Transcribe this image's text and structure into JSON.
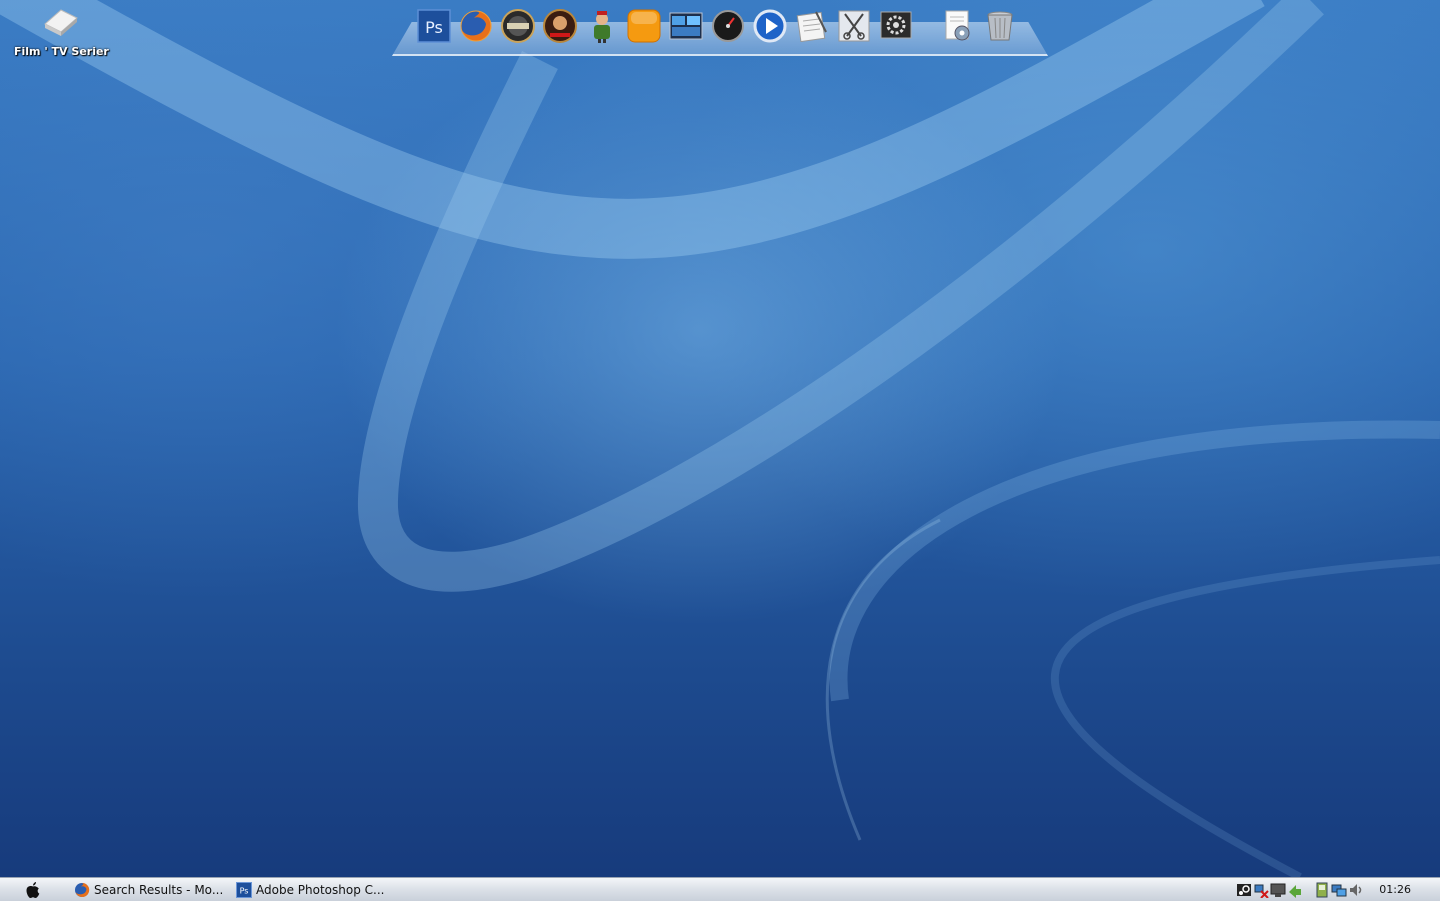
{
  "desktop": {
    "icons": [
      {
        "label": "Film ' TV Serier",
        "icon": "drive-icon"
      }
    ]
  },
  "dock": {
    "items": [
      {
        "name": "photoshop",
        "text": "Ps",
        "icon": "photoshop-icon"
      },
      {
        "name": "firefox",
        "icon": "firefox-icon"
      },
      {
        "name": "football-manager",
        "icon": "football-manager-icon"
      },
      {
        "name": "red-alert",
        "icon": "red-alert-icon"
      },
      {
        "name": "game-character",
        "icon": "character-icon"
      },
      {
        "name": "orange-app",
        "icon": "orange-square-icon"
      },
      {
        "name": "media-window",
        "icon": "window-icon"
      },
      {
        "name": "dashboard",
        "icon": "gauge-icon"
      },
      {
        "name": "media-player",
        "icon": "play-icon"
      },
      {
        "name": "text-editor",
        "icon": "notepad-icon"
      },
      {
        "name": "utilities",
        "icon": "scissors-icon"
      },
      {
        "name": "system-preferences",
        "icon": "settings-icon"
      },
      {
        "name": "document",
        "icon": "document-gear-icon"
      },
      {
        "name": "trash",
        "icon": "trash-icon"
      }
    ],
    "active_dots": [
      "photoshop",
      "firefox",
      "game-character"
    ]
  },
  "taskbar": {
    "start_icon": "apple-icon",
    "tasks": [
      {
        "label": "Search Results - Mo...",
        "icon": "firefox-icon"
      },
      {
        "label": "Adobe Photoshop C...",
        "icon": "photoshop-icon",
        "icon_text": "Ps"
      }
    ],
    "tray_icons": [
      "steam-icon",
      "network-error-icon",
      "display-icon",
      "arrow-icon",
      "device-icon",
      "network-icon",
      "volume-icon"
    ],
    "clock": "01:26"
  },
  "colors": {
    "wallpaper_top": "#3a7cc4",
    "wallpaper_bottom": "#16397a",
    "taskbar": "#dde2e9",
    "photoshop": "#1d4f9c",
    "orange_app": "#f59a10"
  }
}
